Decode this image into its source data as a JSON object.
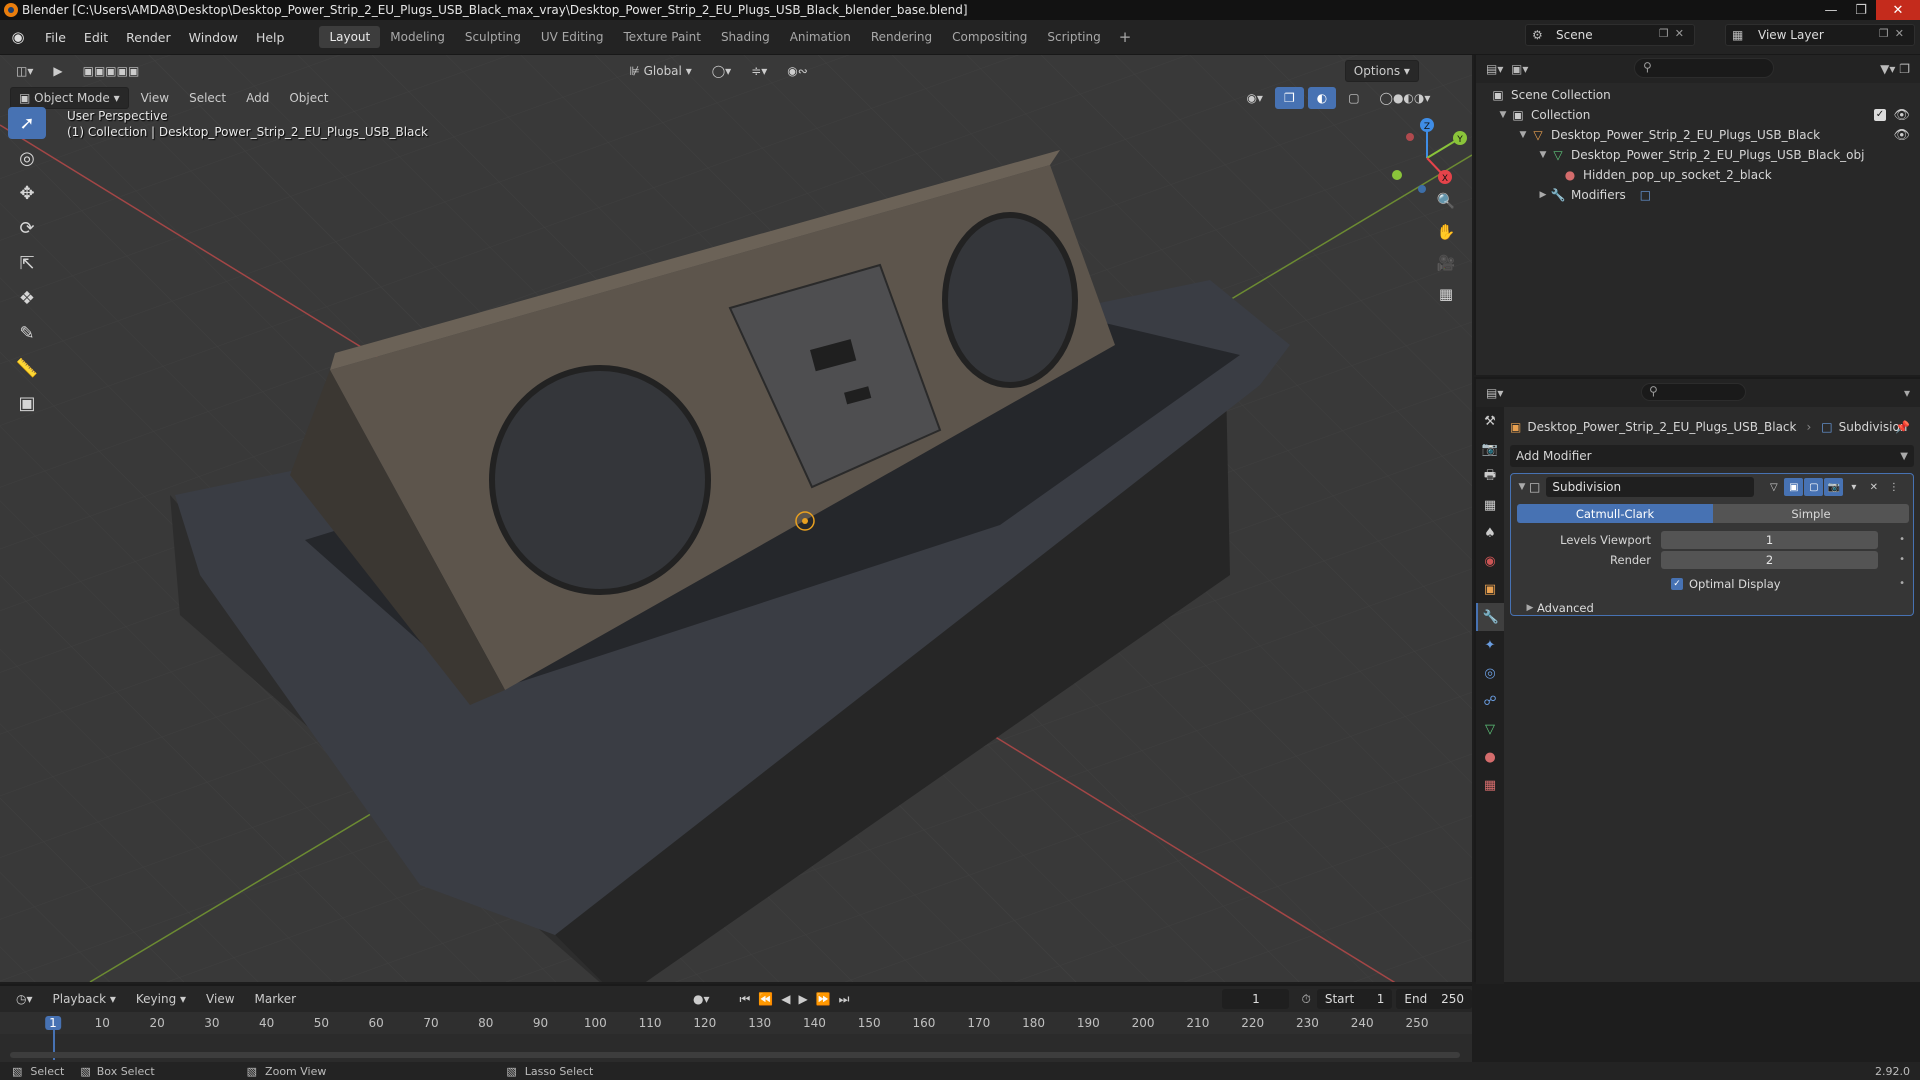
{
  "window": {
    "title": "Blender [C:\\Users\\AMDA8\\Desktop\\Desktop_Power_Strip_2_EU_Plugs_USB_Black_max_vray\\Desktop_Power_Strip_2_EU_Plugs_USB_Black_blender_base.blend]"
  },
  "menu": [
    "File",
    "Edit",
    "Render",
    "Window",
    "Help"
  ],
  "workspaces": [
    "Layout",
    "Modeling",
    "Sculpting",
    "UV Editing",
    "Texture Paint",
    "Shading",
    "Animation",
    "Rendering",
    "Compositing",
    "Scripting"
  ],
  "scene": {
    "name": "Scene",
    "view_layer": "View Layer"
  },
  "viewport": {
    "mode": "Object Mode",
    "menus": [
      "View",
      "Select",
      "Add",
      "Object"
    ],
    "orientation": "Global",
    "options_label": "Options",
    "perspective_label": "User Perspective",
    "collection_label": "(1) Collection | Desktop_Power_Strip_2_EU_Plugs_USB_Black",
    "gizmo_axes": {
      "x": "X",
      "y": "Y",
      "z": "Z"
    }
  },
  "outliner": {
    "root": "Scene Collection",
    "collection": "Collection",
    "object": "Desktop_Power_Strip_2_EU_Plugs_USB_Black",
    "mesh": "Desktop_Power_Strip_2_EU_Plugs_USB_Black_obj",
    "material": "Hidden_pop_up_socket_2_black",
    "modifiers": "Modifiers"
  },
  "properties": {
    "object_name": "Desktop_Power_Strip_2_EU_Plugs_USB_Black",
    "modifier_crumb": "Subdivision",
    "add_modifier": "Add Modifier",
    "modifier": {
      "name": "Subdivision",
      "method_on": "Catmull-Clark",
      "method_off": "Simple",
      "levels_viewport_label": "Levels Viewport",
      "levels_viewport": "1",
      "render_label": "Render",
      "render": "2",
      "optimal_display_label": "Optimal Display",
      "advanced_label": "Advanced"
    }
  },
  "timeline": {
    "menus": [
      "Playback",
      "Keying",
      "View",
      "Marker"
    ],
    "current_frame": "1",
    "start_label": "Start",
    "start": "1",
    "end_label": "End",
    "end": "250",
    "ticks": [
      "1",
      "10",
      "20",
      "30",
      "40",
      "50",
      "60",
      "70",
      "80",
      "90",
      "100",
      "110",
      "120",
      "130",
      "140",
      "150",
      "160",
      "170",
      "180",
      "190",
      "200",
      "210",
      "220",
      "230",
      "240",
      "250"
    ]
  },
  "status": {
    "select": "Select",
    "box_select": "Box Select",
    "zoom_view": "Zoom View",
    "lasso_select": "Lasso Select",
    "version": "2.92.0"
  },
  "colors": {
    "accent": "#4772b3",
    "x_axis": "#e5434a",
    "y_axis": "#8ac43a",
    "z_axis": "#3f8de6"
  }
}
